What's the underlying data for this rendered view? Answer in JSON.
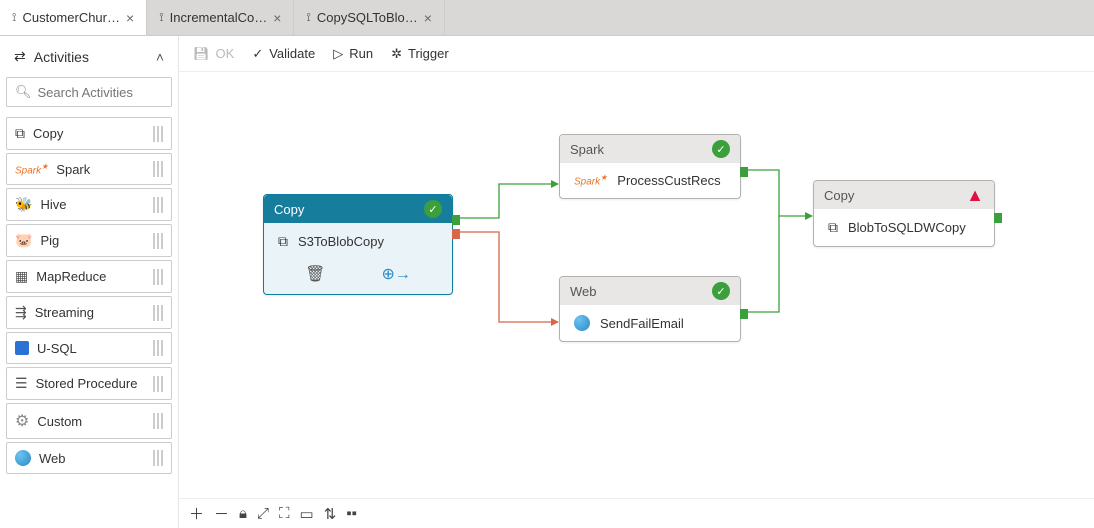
{
  "tabs": [
    {
      "label": "CustomerChur…",
      "active": true
    },
    {
      "label": "IncrementalCo…",
      "active": false
    },
    {
      "label": "CopySQLToBlo…",
      "active": false
    }
  ],
  "sidebar": {
    "title": "Activities",
    "search_placeholder": "Search Activities",
    "items": [
      {
        "label": "Copy"
      },
      {
        "label": "Spark"
      },
      {
        "label": "Hive"
      },
      {
        "label": "Pig"
      },
      {
        "label": "MapReduce"
      },
      {
        "label": "Streaming"
      },
      {
        "label": "U-SQL"
      },
      {
        "label": "Stored Procedure"
      },
      {
        "label": "Custom"
      },
      {
        "label": "Web"
      }
    ]
  },
  "toolbar": {
    "ok": "OK",
    "validate": "Validate",
    "run": "Run",
    "trigger": "Trigger"
  },
  "nodes": {
    "s3copy": {
      "type": "Copy",
      "name": "S3ToBlobCopy",
      "status": "ok"
    },
    "spark": {
      "type": "Spark",
      "name": "ProcessCustRecs",
      "status": "ok"
    },
    "web": {
      "type": "Web",
      "name": "SendFailEmail",
      "status": "ok"
    },
    "dwcopy": {
      "type": "Copy",
      "name": "BlobToSQLDWCopy",
      "status": "warn"
    }
  }
}
